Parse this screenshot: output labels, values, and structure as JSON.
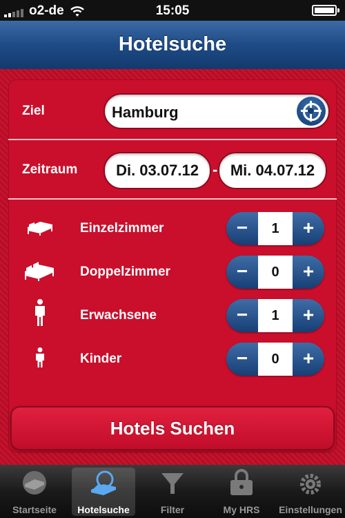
{
  "status_bar": {
    "carrier": "o2-de",
    "time": "15:05"
  },
  "nav": {
    "title": "Hotelsuche"
  },
  "form": {
    "ziel_label": "Ziel",
    "ziel_value": "Hamburg",
    "zeitraum_label": "Zeitraum",
    "date_from": "Di. 03.07.12",
    "date_separator": "-",
    "date_to": "Mi. 04.07.12",
    "rooms": [
      {
        "label": "Einzelzimmer",
        "value": "1",
        "icon": "single-bed-icon"
      },
      {
        "label": "Doppelzimmer",
        "value": "0",
        "icon": "double-bed-icon"
      },
      {
        "label": "Erwachsene",
        "value": "1",
        "icon": "adult-icon"
      },
      {
        "label": "Kinder",
        "value": "0",
        "icon": "child-icon"
      }
    ],
    "minus": "−",
    "plus": "+"
  },
  "search_button": "Hotels Suchen",
  "tabs": [
    {
      "label": "Startseite",
      "icon": "bed-icon",
      "active": false
    },
    {
      "label": "Hotelsuche",
      "icon": "magnifier-bed-icon",
      "active": true
    },
    {
      "label": "Filter",
      "icon": "filter-icon",
      "active": false
    },
    {
      "label": "My HRS",
      "icon": "lock-icon",
      "active": false
    },
    {
      "label": "Einstellungen",
      "icon": "gear-icon",
      "active": false
    }
  ],
  "colors": {
    "primary_red": "#c90f2c",
    "nav_blue": "#1e4b86",
    "stepper_blue": "#173f75"
  }
}
